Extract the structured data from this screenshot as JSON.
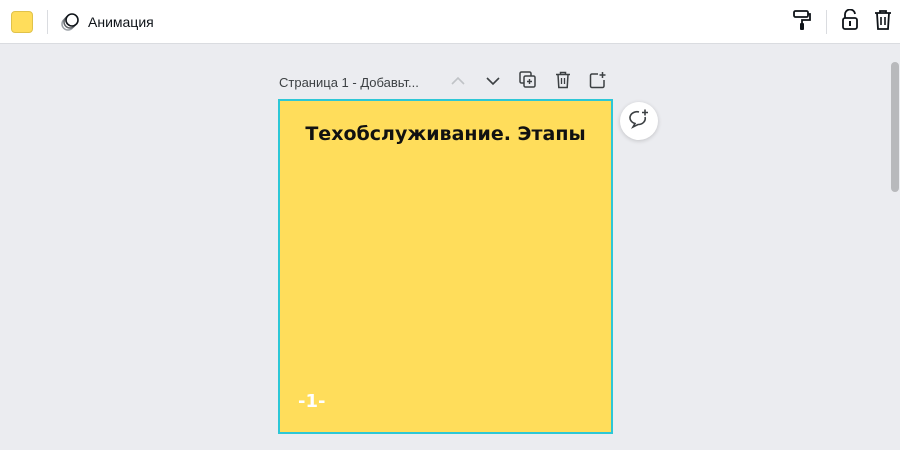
{
  "toolbar": {
    "color_swatch": "#ffdd5b",
    "animation_label": "Анимация",
    "icons": [
      "paint-roller-icon",
      "lock-open-icon",
      "trash-icon"
    ]
  },
  "page_header": {
    "title": "Страница 1 - Добавьт...",
    "icons": [
      "chevron-up-icon",
      "chevron-down-icon",
      "duplicate-page-icon",
      "trash-icon",
      "add-page-icon"
    ]
  },
  "page": {
    "heading": "Техобслуживание. Этапы",
    "number": "-1-",
    "background": "#ffdd5b",
    "selection_color": "#2dc7d6"
  },
  "comment_icon": "add-comment-icon"
}
